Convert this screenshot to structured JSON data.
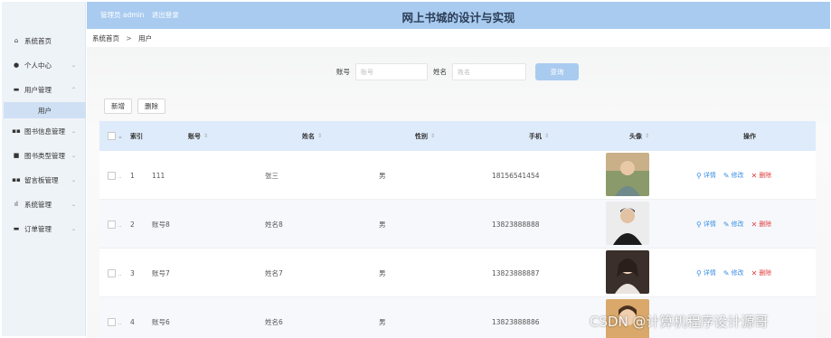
{
  "header": {
    "admin_role": "管理员 admin",
    "logout": "退出登录",
    "title": "网上书城的设计与实现"
  },
  "breadcrumb": {
    "home": "系统首页",
    "separator": ">",
    "current": "用户"
  },
  "sidebar": {
    "items": [
      {
        "label": "系统首页",
        "icon": "home-icon"
      },
      {
        "label": "个人中心",
        "icon": "user-icon",
        "chevron": "⌄"
      },
      {
        "label": "用户管理",
        "icon": "card-icon",
        "chevron": "⌃"
      },
      {
        "label": "用户",
        "sub": true
      },
      {
        "label": "图书信息管理",
        "icon": "grid-icon",
        "chevron": "⌄"
      },
      {
        "label": "图书类型管理",
        "icon": "book-icon",
        "chevron": "⌄"
      },
      {
        "label": "留言板管理",
        "icon": "grid-icon",
        "chevron": "⌄"
      },
      {
        "label": "系统管理",
        "icon": "chart-icon",
        "chevron": "⌄"
      },
      {
        "label": "订单管理",
        "icon": "monitor-icon",
        "chevron": "⌄"
      }
    ]
  },
  "search": {
    "account_label": "账号",
    "account_placeholder": "账号",
    "name_label": "姓名",
    "name_placeholder": "姓名",
    "button": "查询"
  },
  "actions": {
    "add": "新增",
    "delete": "删除"
  },
  "table": {
    "headers": {
      "index": "索引",
      "account": "账号",
      "name": "姓名",
      "gender": "性别",
      "phone": "手机",
      "avatar": "头像",
      "ops": "操作"
    },
    "sort_glyph": "⇕",
    "rows": [
      {
        "index": "1",
        "account": "111",
        "name": "张三",
        "gender": "男",
        "phone": "18156541454"
      },
      {
        "index": "2",
        "account": "账号8",
        "name": "姓名8",
        "gender": "男",
        "phone": "13823888888"
      },
      {
        "index": "3",
        "account": "账号7",
        "name": "姓名7",
        "gender": "男",
        "phone": "13823888887"
      },
      {
        "index": "4",
        "account": "账号6",
        "name": "姓名6",
        "gender": "男",
        "phone": "13823888886"
      }
    ],
    "ops": {
      "view": "详情",
      "edit": "修改",
      "del": "删除"
    }
  },
  "watermark": "CSDN @计算机程序设计源哥",
  "colors": {
    "header_bg": "#a9cbf0",
    "sidebar_bg": "#eef3f8",
    "table_head_bg": "#deebfa",
    "link": "#3a8ee6",
    "danger": "#e04040"
  }
}
